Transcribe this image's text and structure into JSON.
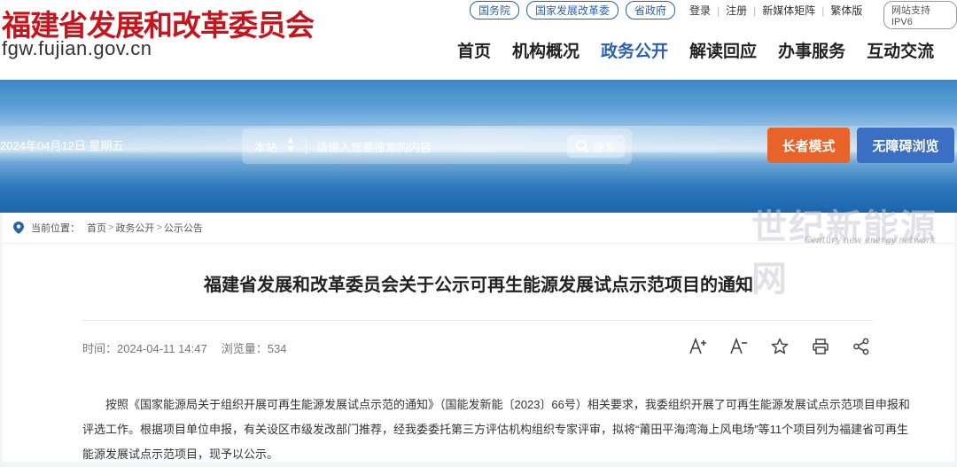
{
  "header": {
    "site_name": "福建省发展和改革委员会",
    "site_url": "fgw.fujian.gov.cn",
    "pill_links": [
      "国务院",
      "国家发展改革委",
      "省政府"
    ],
    "top_links": [
      "登录",
      "注册",
      "新媒体矩阵",
      "繁体版"
    ],
    "ipv6_badge": "网站支持IPV6",
    "nav": [
      "首页",
      "机构概况",
      "政务公开",
      "解读回应",
      "办事服务",
      "互动交流"
    ],
    "nav_active": "政务公开"
  },
  "banner": {
    "date": "2024年04月12日 星期五",
    "search_scope": "本站",
    "search_placeholder": "请输入您要搜索的内容",
    "search_button": "搜索",
    "elder_mode": "长者模式",
    "accessible": "无障碍浏览"
  },
  "breadcrumb": {
    "label": "当前位置：",
    "items": [
      "首页",
      "政务公开",
      "公示公告"
    ]
  },
  "article": {
    "title": "福建省发展和改革委员会关于公示可再生能源发展试点示范项目的通知",
    "time_label": "时间：",
    "time": "2024-04-11 14:47",
    "views_label": "浏览量：",
    "views": "534",
    "tools": [
      "font-increase-icon",
      "font-decrease-icon",
      "star-icon",
      "print-icon",
      "share-icon"
    ],
    "body": [
      "按照《国家能源局关于组织开展可再生能源发展试点示范的通知》（国能发新能〔2023〕66号）相关要求，我委组织开展了可再生能源发展试点示范项目申报和评选工作。根据项目单位申报，有关设区市级发改部门推荐，经我委委托第三方评估机构组织专家评审，拟将“莆田平海湾海上风电场”等11个项目列为福建省可再生能源发展试点示范项目，现予以公示。"
    ]
  },
  "watermark": {
    "main": "世纪新能源网",
    "sub": "Century new energy network"
  }
}
